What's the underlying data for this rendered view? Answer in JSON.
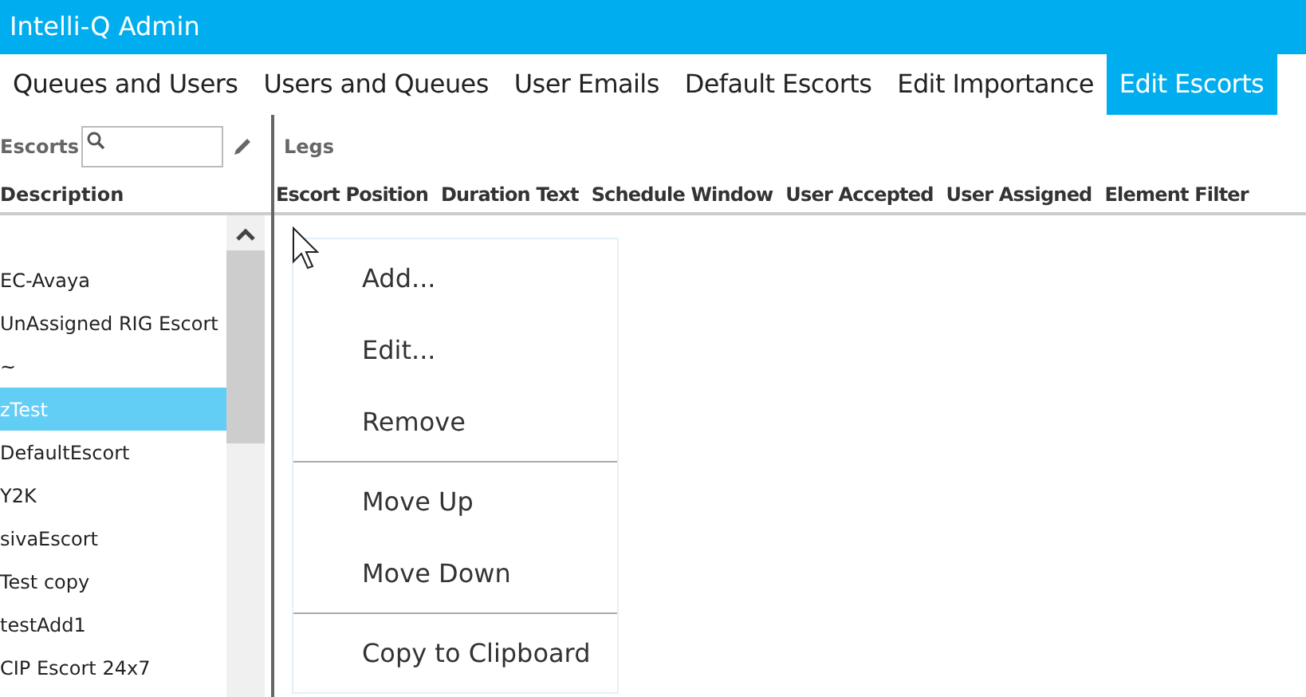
{
  "window": {
    "title": "Intelli-Q Admin"
  },
  "tabs": [
    {
      "label": "Queues and Users",
      "selected": false
    },
    {
      "label": "Users and Queues",
      "selected": false
    },
    {
      "label": "User Emails",
      "selected": false
    },
    {
      "label": "Default Escorts",
      "selected": false
    },
    {
      "label": "Edit Importance",
      "selected": false
    },
    {
      "label": "Edit Escorts",
      "selected": true
    }
  ],
  "escorts": {
    "label": "Escorts",
    "column": "Description",
    "items": [
      {
        "label": "EC-Avaya",
        "selected": false
      },
      {
        "label": "UnAssigned RIG Escort",
        "selected": false
      },
      {
        "label": "~",
        "selected": false
      },
      {
        "label": "zTest",
        "selected": true
      },
      {
        "label": "DefaultEscort",
        "selected": false
      },
      {
        "label": "Y2K",
        "selected": false
      },
      {
        "label": "sivaEscort",
        "selected": false
      },
      {
        "label": "Test copy",
        "selected": false
      },
      {
        "label": "testAdd1",
        "selected": false
      },
      {
        "label": "CIP Escort 24x7",
        "selected": false
      }
    ]
  },
  "legs": {
    "label": "Legs",
    "columns": [
      "Escort Position",
      "Duration Text",
      "Schedule Window",
      "User Accepted",
      "User Assigned",
      "Element Filter"
    ]
  },
  "context_menu": {
    "groups": [
      [
        {
          "label": "Add..."
        },
        {
          "label": "Edit..."
        },
        {
          "label": "Remove"
        }
      ],
      [
        {
          "label": "Move Up"
        },
        {
          "label": "Move Down"
        }
      ],
      [
        {
          "label": "Copy to Clipboard"
        }
      ]
    ]
  }
}
